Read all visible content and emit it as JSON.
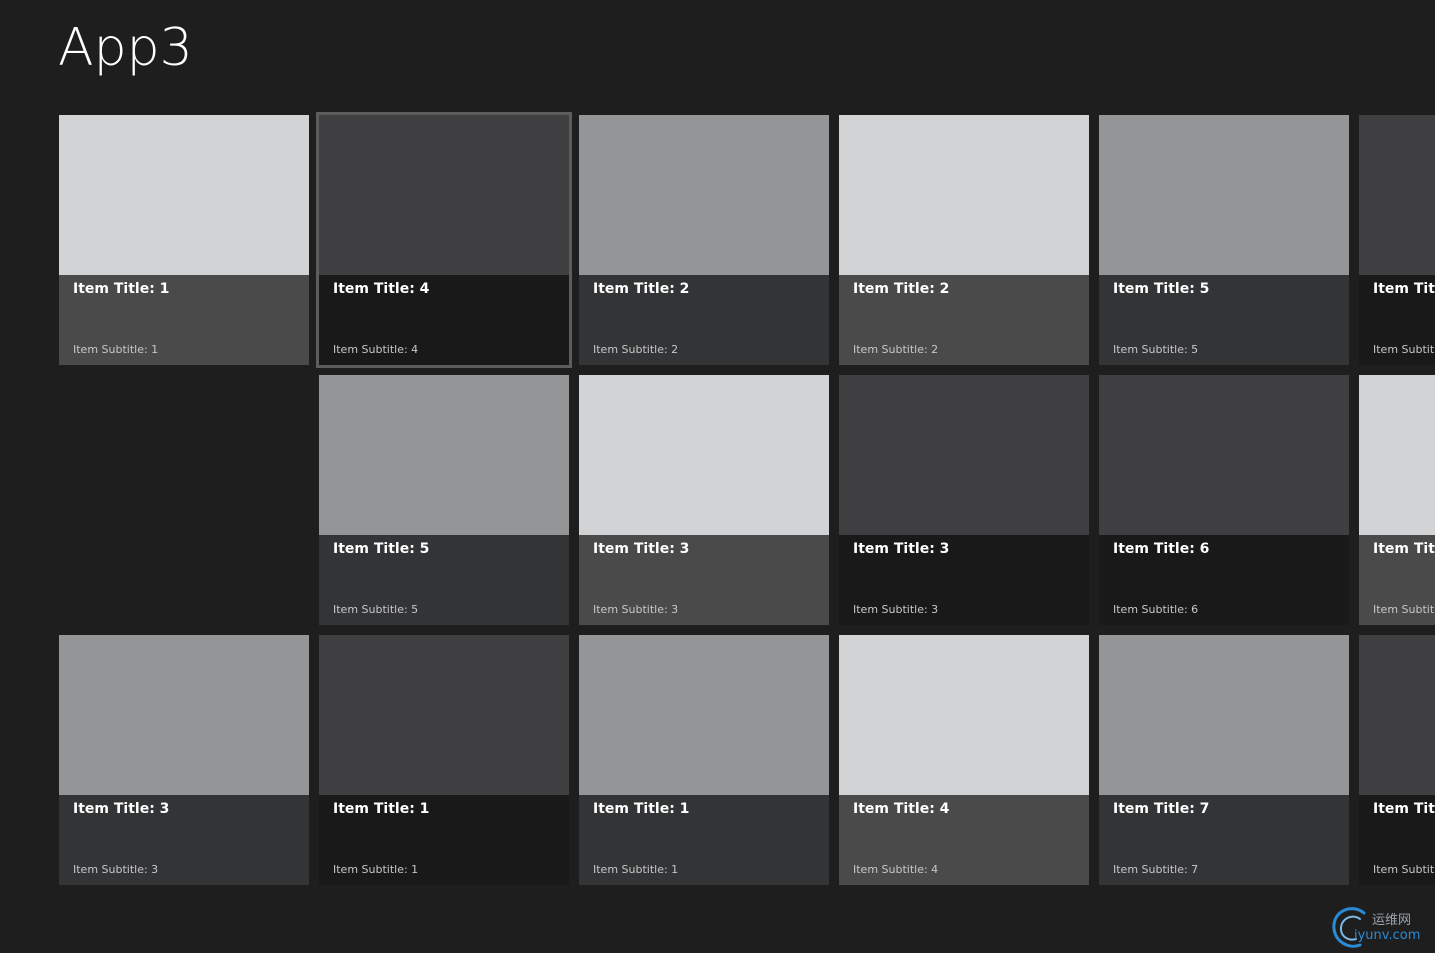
{
  "app": {
    "title": "App3"
  },
  "colors": {
    "background": "#1e1e1e",
    "selection_border": "#5c5c5c"
  },
  "tiles": [
    {
      "title": "Item Title: 1",
      "subtitle": "Item Subtitle: 1",
      "image_color": "#d2d3d4",
      "overlay_color": "#4a4a4a",
      "selected": false
    },
    {
      "title": "Item Title: 4",
      "subtitle": "Item Subtitle: 4",
      "image_color": "#3f3f41",
      "overlay_color": "#19191a",
      "selected": true
    },
    {
      "title": "Item Title: 2",
      "subtitle": "Item Subtitle: 2",
      "image_color": "#949597",
      "overlay_color": "#333436",
      "selected": false
    },
    {
      "title": "Item Title: 2",
      "subtitle": "Item Subtitle: 2",
      "image_color": "#d2d3d4",
      "overlay_color": "#4a4a4a",
      "selected": false
    },
    {
      "title": "Item Title: 5",
      "subtitle": "Item Subtitle: 5",
      "image_color": "#949597",
      "overlay_color": "#333436",
      "selected": false
    },
    {
      "title": "Item Title",
      "subtitle": "Item Subtitl",
      "image_color": "#3f3f41",
      "overlay_color": "#19191a",
      "selected": false
    },
    {
      "title": "Item Title: 5",
      "subtitle": "Item Subtitle: 5",
      "image_color": "#949597",
      "overlay_color": "#333436",
      "selected": false
    },
    {
      "title": "Item Title: 3",
      "subtitle": "Item Subtitle: 3",
      "image_color": "#d2d3d4",
      "overlay_color": "#4a4a4a",
      "selected": false
    },
    {
      "title": "Item Title: 3",
      "subtitle": "Item Subtitle: 3",
      "image_color": "#3f3f41",
      "overlay_color": "#19191a",
      "selected": false
    },
    {
      "title": "Item Title: 6",
      "subtitle": "Item Subtitle: 6",
      "image_color": "#3f3f41",
      "overlay_color": "#19191a",
      "selected": false
    },
    {
      "title": "Item Title",
      "subtitle": "Item Subtitl",
      "image_color": "#d2d3d4",
      "overlay_color": "#4a4a4a",
      "selected": false
    },
    {
      "title": "Item Title: 3",
      "subtitle": "Item Subtitle: 3",
      "image_color": "#949597",
      "overlay_color": "#333436",
      "selected": false
    },
    {
      "title": "Item Title: 1",
      "subtitle": "Item Subtitle: 1",
      "image_color": "#3f3f41",
      "overlay_color": "#19191a",
      "selected": false
    },
    {
      "title": "Item Title: 1",
      "subtitle": "Item Subtitle: 1",
      "image_color": "#949597",
      "overlay_color": "#333436",
      "selected": false
    },
    {
      "title": "Item Title: 4",
      "subtitle": "Item Subtitle: 4",
      "image_color": "#d2d3d4",
      "overlay_color": "#4a4a4a",
      "selected": false
    },
    {
      "title": "Item Title: 7",
      "subtitle": "Item Subtitle: 7",
      "image_color": "#949597",
      "overlay_color": "#333436",
      "selected": false
    },
    {
      "title": "Item Title",
      "subtitle": "Item Subtitl",
      "image_color": "#3f3f41",
      "overlay_color": "#19191a",
      "selected": false
    }
  ],
  "watermark": {
    "line1": "运维网",
    "line2": "iyunv.com",
    "icon": "swirl-logo-icon"
  }
}
